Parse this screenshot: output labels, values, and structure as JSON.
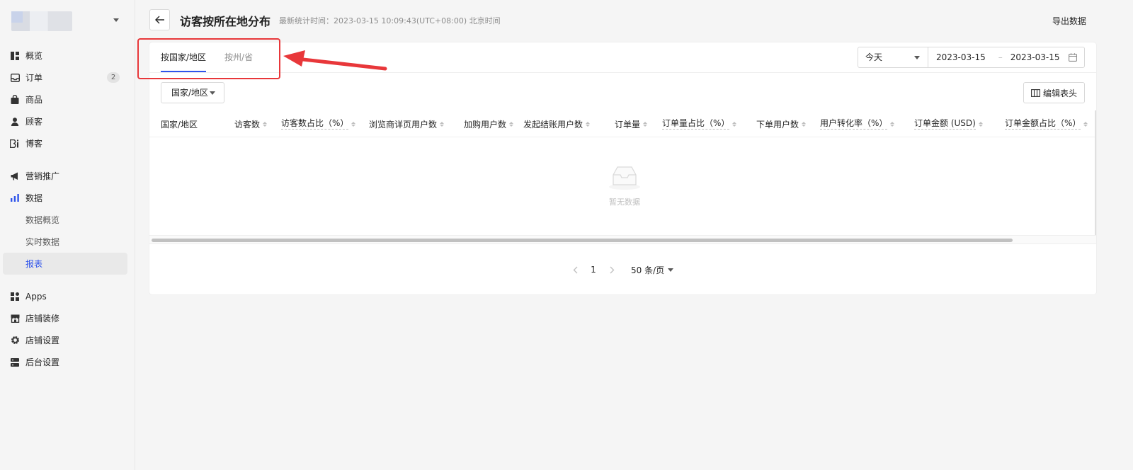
{
  "sidebar": {
    "store_name": "",
    "items": [
      {
        "label": "概览",
        "icon": "dashboard-icon"
      },
      {
        "label": "订单",
        "icon": "inbox-icon",
        "badge": "2"
      },
      {
        "label": "商品",
        "icon": "shopping-bag-icon"
      },
      {
        "label": "顾客",
        "icon": "user-icon"
      },
      {
        "label": "博客",
        "icon": "blog-icon"
      },
      {
        "label": "营销推广",
        "icon": "megaphone-icon"
      },
      {
        "label": "数据",
        "icon": "bar-chart-icon"
      },
      {
        "label": "Apps",
        "icon": "apps-icon"
      },
      {
        "label": "店铺装修",
        "icon": "storefront-icon"
      },
      {
        "label": "店铺设置",
        "icon": "gear-icon"
      },
      {
        "label": "后台设置",
        "icon": "server-icon"
      }
    ],
    "data_sub": [
      "数据概览",
      "实时数据",
      "报表"
    ]
  },
  "header": {
    "title": "访客按所在地分布",
    "stat_time": "最新统计时间：2023-03-15 10:09:43(UTC+08:00) 北京时间",
    "export_label": "导出数据"
  },
  "tabs": [
    "按国家/地区",
    "按州/省"
  ],
  "date_filter": {
    "range_label": "今天",
    "start": "2023-03-15",
    "separator": "–",
    "end": "2023-03-15"
  },
  "country_filter": "国家/地区",
  "edit_columns_label": "编辑表头",
  "table": {
    "columns": [
      "国家/地区",
      "访客数",
      "访客数占比（%）",
      "浏览商详页用户数",
      "加购用户数",
      "发起结账用户数",
      "订单量",
      "订单量占比（%）",
      "下单用户数",
      "用户转化率（%）",
      "订单金额 (USD)",
      "订单金额占比（%）"
    ],
    "empty_text": "暂无数据"
  },
  "pagination": {
    "page": "1",
    "page_size": "50 条/页"
  },
  "colors": {
    "accent": "#2f54eb",
    "annotation": "#e8373a"
  }
}
